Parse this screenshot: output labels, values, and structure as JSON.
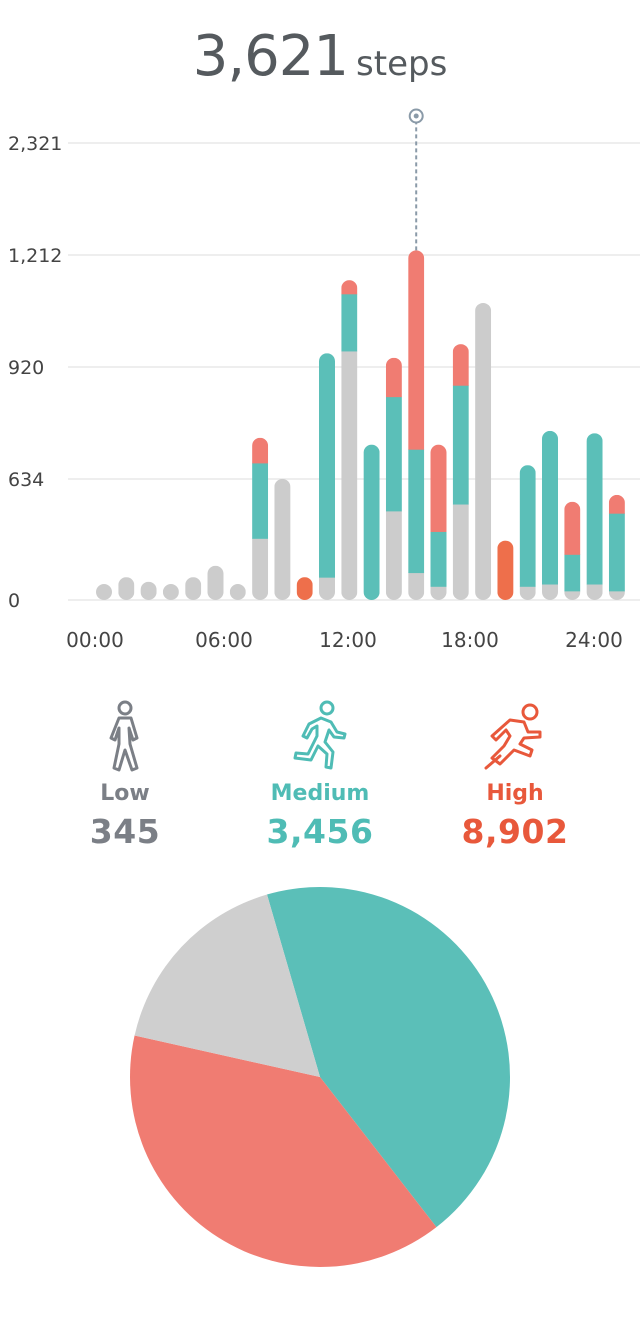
{
  "header": {
    "steps_value": "3,621",
    "steps_unit": "steps"
  },
  "chart_data": [
    {
      "type": "bar",
      "stacked": true,
      "y_ticks": [
        "2,321",
        "1,212",
        "920",
        "634",
        "0"
      ],
      "x_ticks": [
        "00:00",
        "06:00",
        "12:00",
        "18:00",
        "24:00"
      ],
      "grid": true,
      "selected_index": 14,
      "series_colors": {
        "low": "#cccccc",
        "medium": "#5bbfb8",
        "high": "#f07c72",
        "high_only": "#ee6f4b"
      },
      "bars": [
        {
          "low": 0.035,
          "medium": 0,
          "high": 0
        },
        {
          "low": 0.05,
          "medium": 0,
          "high": 0
        },
        {
          "low": 0.04,
          "medium": 0,
          "high": 0
        },
        {
          "low": 0.035,
          "medium": 0,
          "high": 0
        },
        {
          "low": 0.05,
          "medium": 0,
          "high": 0
        },
        {
          "low": 0.075,
          "medium": 0,
          "high": 0
        },
        {
          "low": 0.035,
          "medium": 0,
          "high": 0
        },
        {
          "low": 0.135,
          "medium": 0.165,
          "high": 0.055
        },
        {
          "low": 0.265,
          "medium": 0,
          "high": 0
        },
        {
          "low": 0,
          "medium": 0,
          "high": 0.05
        },
        {
          "low": 0.05,
          "medium": 0.49,
          "high": 0
        },
        {
          "low": 0.545,
          "medium": 0.125,
          "high": 0.03
        },
        {
          "low": 0,
          "medium": 0.34,
          "high": 0
        },
        {
          "low": 0.195,
          "medium": 0.25,
          "high": 0.085
        },
        {
          "low": 0.06,
          "medium": 0.27,
          "high": 0.435
        },
        {
          "low": 0.03,
          "medium": 0.12,
          "high": 0.19
        },
        {
          "low": 0.21,
          "medium": 0.26,
          "high": 0.09
        },
        {
          "low": 0.65,
          "medium": 0,
          "high": 0
        },
        {
          "low": 0,
          "medium": 0,
          "high": 0.13
        },
        {
          "low": 0.03,
          "medium": 0.265,
          "high": 0
        },
        {
          "low": 0.035,
          "medium": 0.335,
          "high": 0
        },
        {
          "low": 0.02,
          "medium": 0.08,
          "high": 0.115
        },
        {
          "low": 0.035,
          "medium": 0.33,
          "high": 0
        },
        {
          "low": 0.02,
          "medium": 0.17,
          "high": 0.04
        }
      ]
    },
    {
      "type": "pie",
      "slices": [
        {
          "label": "Medium",
          "value": 44,
          "color": "#5bbfb8"
        },
        {
          "label": "High",
          "value": 39,
          "color": "#f07c72"
        },
        {
          "label": "Low",
          "value": 17,
          "color": "#cfcfcf"
        }
      ]
    }
  ],
  "levels": [
    {
      "label": "Low",
      "value": "345",
      "color": "#7b7f86",
      "icon": "walking-icon"
    },
    {
      "label": "Medium",
      "value": "3,456",
      "color": "#4fbcb5",
      "icon": "running-icon"
    },
    {
      "label": "High",
      "value": "8,902",
      "color": "#e8583b",
      "icon": "sprinting-icon"
    }
  ]
}
